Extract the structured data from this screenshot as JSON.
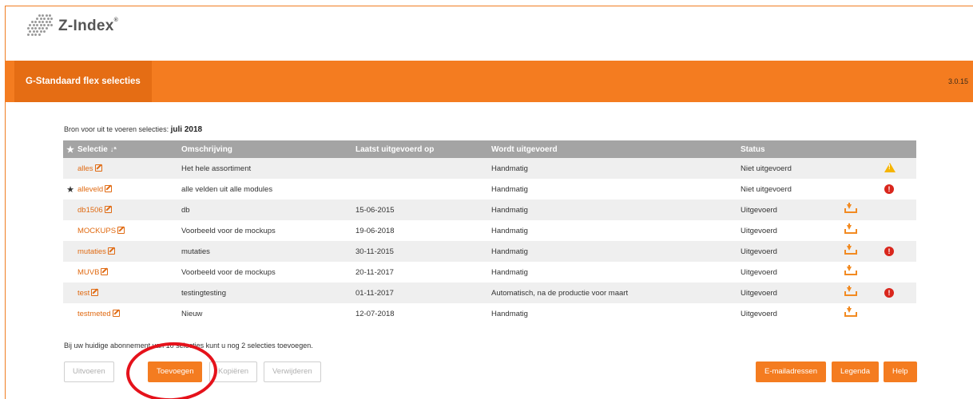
{
  "brand": {
    "name": "Z-Index",
    "trademark": "®"
  },
  "header": {
    "title": "G-Standaard flex selecties",
    "version": "3.0.15"
  },
  "source": {
    "label": "Bron voor uit te voeren selecties:",
    "value": "juli 2018"
  },
  "table": {
    "columns": [
      "Selectie",
      "Omschrijving",
      "Laatst uitgevoerd op",
      "Wordt uitgevoerd",
      "Status"
    ],
    "rows": [
      {
        "favorite": false,
        "name": "alles",
        "description": "Het hele assortiment",
        "last_run": "",
        "schedule": "Handmatig",
        "status": "Niet uitgevoerd",
        "download": false,
        "alert": "warning"
      },
      {
        "favorite": true,
        "name": "alleveld",
        "description": "alle velden uit alle modules",
        "last_run": "",
        "schedule": "Handmatig",
        "status": "Niet uitgevoerd",
        "download": false,
        "alert": "error"
      },
      {
        "favorite": false,
        "name": "db1506",
        "description": "db",
        "last_run": "15-06-2015",
        "schedule": "Handmatig",
        "status": "Uitgevoerd",
        "download": true,
        "alert": ""
      },
      {
        "favorite": false,
        "name": "MOCKUPS",
        "description": "Voorbeeld voor de mockups",
        "last_run": "19-06-2018",
        "schedule": "Handmatig",
        "status": "Uitgevoerd",
        "download": true,
        "alert": ""
      },
      {
        "favorite": false,
        "name": "mutaties",
        "description": "mutaties",
        "last_run": "30-11-2015",
        "schedule": "Handmatig",
        "status": "Uitgevoerd",
        "download": true,
        "alert": "error"
      },
      {
        "favorite": false,
        "name": "MUVB",
        "description": "Voorbeeld voor de mockups",
        "last_run": "20-11-2017",
        "schedule": "Handmatig",
        "status": "Uitgevoerd",
        "download": true,
        "alert": ""
      },
      {
        "favorite": false,
        "name": "test",
        "description": "testingtesting",
        "last_run": "01-11-2017",
        "schedule": "Automatisch, na de productie voor maart",
        "status": "Uitgevoerd",
        "download": true,
        "alert": "error"
      },
      {
        "favorite": false,
        "name": "testmeted",
        "description": "Nieuw",
        "last_run": "12-07-2018",
        "schedule": "Handmatig",
        "status": "Uitgevoerd",
        "download": true,
        "alert": ""
      }
    ]
  },
  "note": "Bij uw huidige abonnement van 10 selecties kunt u nog 2 selecties toevoegen.",
  "actions": {
    "run": "Uitvoeren",
    "add": "Toevoegen",
    "copy": "Kopiëren",
    "delete": "Verwijderen",
    "emails": "E-mailadressen",
    "legend": "Legenda",
    "help": "Help"
  },
  "colors": {
    "accent": "#f47c20",
    "accent_dark": "#e56d14",
    "header_gray": "#a4a4a4",
    "error": "#d9261c",
    "warning": "#f6b400",
    "annotation": "#e5121b"
  }
}
